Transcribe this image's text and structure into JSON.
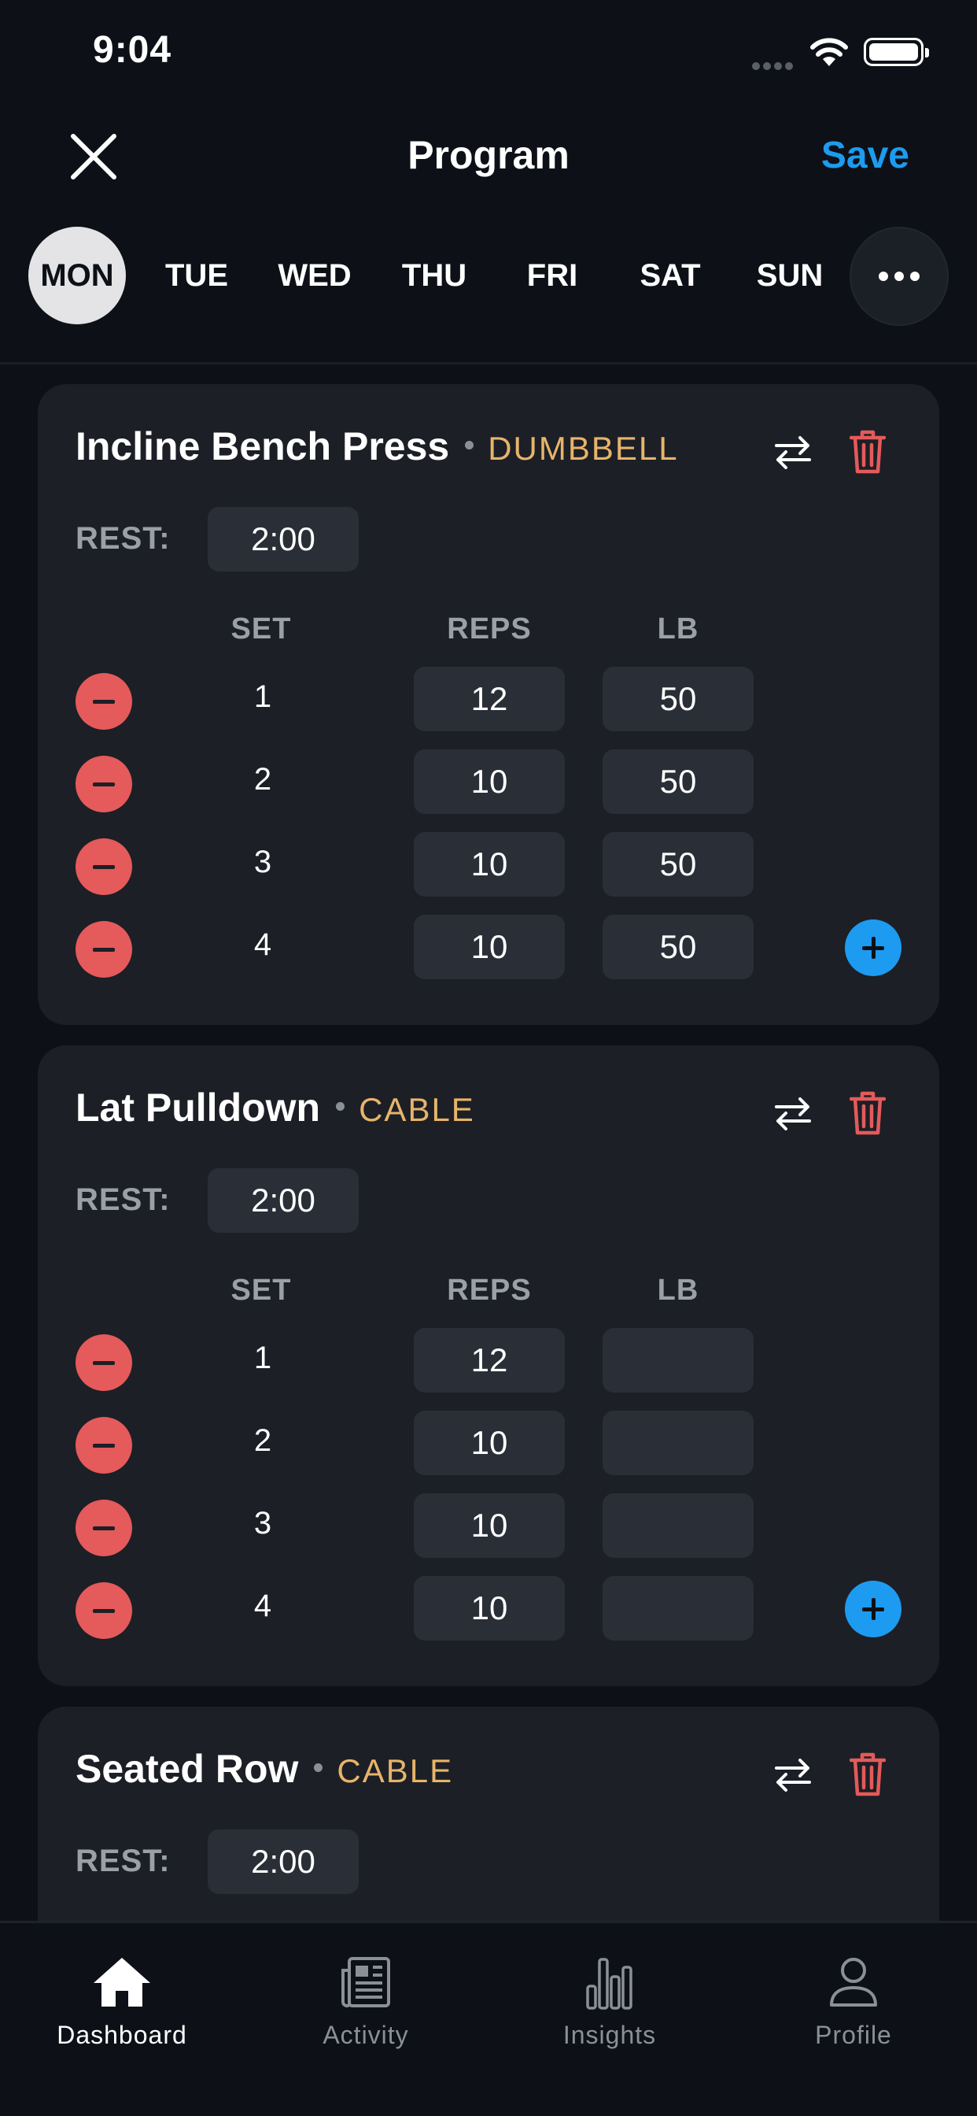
{
  "status_bar": {
    "time": "9:04"
  },
  "header": {
    "title": "Program",
    "save_label": "Save"
  },
  "days": [
    "MON",
    "TUE",
    "WED",
    "THU",
    "FRI",
    "SAT",
    "SUN"
  ],
  "active_day": "MON",
  "column_headers": {
    "set": "SET",
    "reps": "REPS",
    "lb": "LB"
  },
  "exercises": [
    {
      "name": "Incline Bench Press",
      "equipment": "DUMBBELL",
      "rest_label": "REST:",
      "rest": "2:00",
      "sets": [
        {
          "set": "1",
          "reps": "12",
          "lb": "50"
        },
        {
          "set": "2",
          "reps": "10",
          "lb": "50"
        },
        {
          "set": "3",
          "reps": "10",
          "lb": "50"
        },
        {
          "set": "4",
          "reps": "10",
          "lb": "50"
        }
      ]
    },
    {
      "name": "Lat Pulldown",
      "equipment": "CABLE",
      "rest_label": "REST:",
      "rest": "2:00",
      "sets": [
        {
          "set": "1",
          "reps": "12",
          "lb": ""
        },
        {
          "set": "2",
          "reps": "10",
          "lb": ""
        },
        {
          "set": "3",
          "reps": "10",
          "lb": ""
        },
        {
          "set": "4",
          "reps": "10",
          "lb": ""
        }
      ]
    },
    {
      "name": "Seated Row",
      "equipment": "CABLE",
      "rest_label": "REST:",
      "rest": "2:00",
      "sets": []
    }
  ],
  "tabs": [
    {
      "label": "Dashboard",
      "icon": "home-icon",
      "active": true
    },
    {
      "label": "Activity",
      "icon": "newspaper-icon",
      "active": false
    },
    {
      "label": "Insights",
      "icon": "bar-chart-icon",
      "active": false
    },
    {
      "label": "Profile",
      "icon": "person-icon",
      "active": false
    }
  ],
  "colors": {
    "accent": "#1d9bf0",
    "danger": "#e55a5a",
    "equipment": "#e7b46a",
    "card": "#1c1f26",
    "background": "#0d1117"
  }
}
